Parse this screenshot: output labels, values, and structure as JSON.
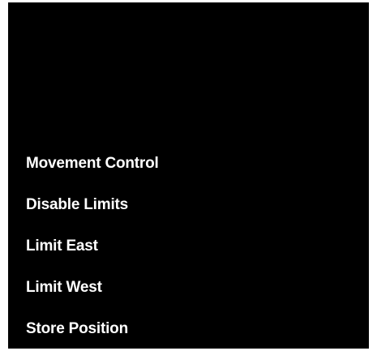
{
  "menu": {
    "items": [
      {
        "label": "Movement Control"
      },
      {
        "label": "Disable Limits"
      },
      {
        "label": "Limit East"
      },
      {
        "label": "Limit West"
      },
      {
        "label": "Store Position"
      }
    ]
  },
  "colors": {
    "screen_background": "#000000",
    "text": "#ffffff",
    "page_background": "#ffffff"
  }
}
